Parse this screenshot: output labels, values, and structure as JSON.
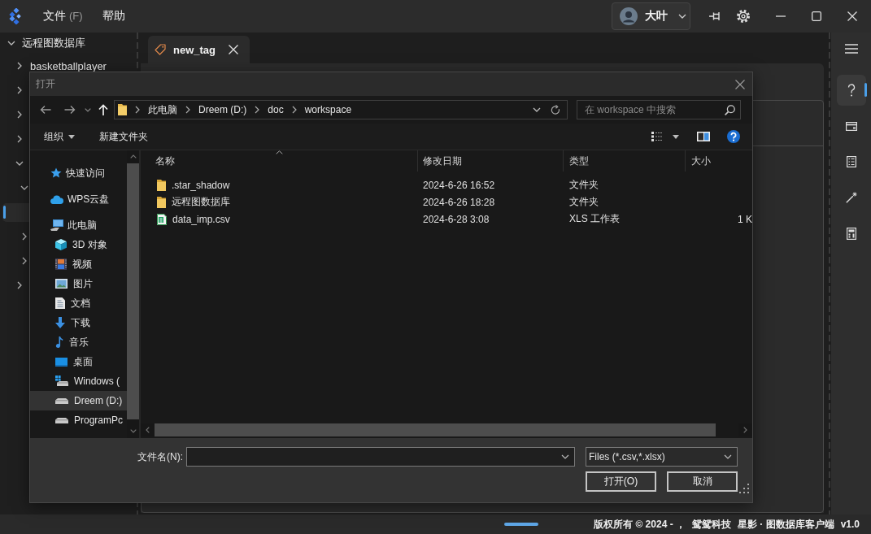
{
  "app_bar": {
    "menus": [
      {
        "label": "文件",
        "accelerator": "(F)"
      },
      {
        "label": "帮助"
      }
    ],
    "user": {
      "name": "大叶"
    }
  },
  "sidebar": {
    "tree": [
      {
        "label": "远程图数据库",
        "expanded": true,
        "selected": false,
        "children": [
          {
            "label": "basketballplayer",
            "expanded": false,
            "selected": false
          },
          {
            "expanded": false,
            "selected": false
          },
          {
            "expanded": false,
            "selected": false
          },
          {
            "expanded": false,
            "selected": false
          },
          {
            "expanded": true,
            "selected": false,
            "children": [
              {
                "expanded": true,
                "selected": false,
                "children": [
                  {
                    "selected": true
                  }
                ]
              },
              {
                "expanded": false,
                "selected": false
              },
              {
                "expanded": false,
                "selected": false
              }
            ]
          },
          {
            "expanded": false,
            "selected": false
          }
        ]
      }
    ]
  },
  "tabs": [
    {
      "label": "new_tag",
      "selected": true
    }
  ],
  "dialog": {
    "title": "打开",
    "address": {
      "path": [
        "此电脑",
        "Dreem (D:)",
        "doc",
        "workspace"
      ]
    },
    "search": {
      "placeholder": "在 workspace 中搜索"
    },
    "toolbar": {
      "organize": "组织",
      "new_folder": "新建文件夹"
    },
    "nav": [
      {
        "label": "快速访问",
        "kind": "star",
        "selected": false
      },
      {
        "label": "WPS云盘",
        "kind": "cloud",
        "selected": false
      },
      {
        "label": "此电脑",
        "kind": "computer",
        "selected": false,
        "children": [
          {
            "label": "3D 对象",
            "kind": "cube",
            "selected": false
          },
          {
            "label": "视频",
            "kind": "video",
            "selected": false
          },
          {
            "label": "图片",
            "kind": "picture",
            "selected": false
          },
          {
            "label": "文档",
            "kind": "document",
            "selected": false
          },
          {
            "label": "下载",
            "kind": "download",
            "selected": false
          },
          {
            "label": "音乐",
            "kind": "music",
            "selected": false
          },
          {
            "label": "桌面",
            "kind": "desktop",
            "selected": false
          },
          {
            "label": "Windows (",
            "kind": "sysdrive",
            "selected": false
          },
          {
            "label": "Dreem (D:)",
            "kind": "drive",
            "selected": true
          },
          {
            "label": "ProgramPc",
            "kind": "drive",
            "selected": false
          }
        ]
      }
    ],
    "columns": [
      {
        "label": "名称",
        "sorted": true
      },
      {
        "label": "修改日期",
        "sorted": false
      },
      {
        "label": "类型",
        "sorted": false
      },
      {
        "label": "大小",
        "sorted": false
      }
    ],
    "files": [
      {
        "name": ".star_shadow",
        "kind": "folder",
        "modified": "2024-6-26 16:52",
        "type": "文件夹"
      },
      {
        "name": "远程图数据库",
        "kind": "folder",
        "modified": "2024-6-26 18:28",
        "type": "文件夹"
      },
      {
        "name": "data_imp.csv",
        "kind": "sheet",
        "modified": "2024-6-28 3:08",
        "type": "XLS 工作表",
        "size": "1 K"
      }
    ],
    "file_name": {
      "label": "文件名(N):"
    },
    "file_type": {
      "value": "Files (*.csv,*.xlsx)"
    },
    "buttons": [
      "打开(O)",
      "取消"
    ]
  },
  "rail": {
    "items": [
      {
        "kind": "help",
        "selected": true
      },
      {
        "kind": "card",
        "selected": false
      },
      {
        "kind": "list",
        "selected": false
      },
      {
        "kind": "wand",
        "selected": false
      },
      {
        "kind": "calculator",
        "selected": false
      }
    ]
  },
  "status_bar": {
    "copyright": "版权所有 © 2024 - ，",
    "company": "鸳鸳科技",
    "product": "星影 · 图数据库客户端",
    "version": "v1.0"
  }
}
